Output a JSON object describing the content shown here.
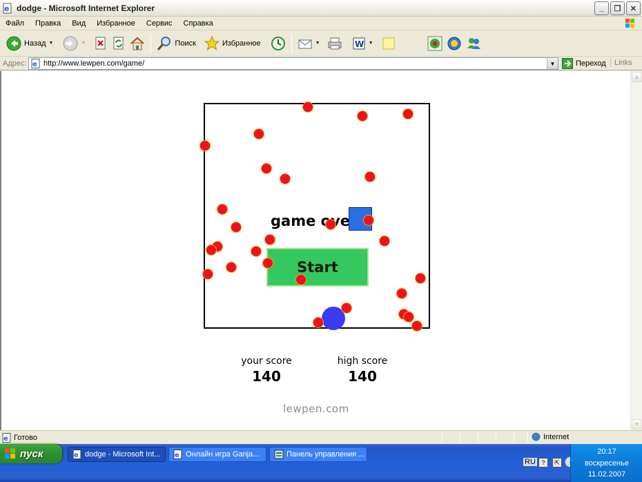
{
  "window": {
    "title": "dodge - Microsoft Internet Explorer",
    "minimize": "_",
    "maximize": "❐",
    "close": "✕"
  },
  "menu": {
    "items": [
      "Файл",
      "Правка",
      "Вид",
      "Избранное",
      "Сервис",
      "Справка"
    ]
  },
  "toolbar": {
    "back_label": "Назад",
    "search_label": "Поиск",
    "favorites_label": "Избранное"
  },
  "address": {
    "label": "Адрес:",
    "url": "http://www.lewpen.com/game/",
    "go_label": "Переход",
    "links_label": "Links"
  },
  "game": {
    "message": "game over",
    "start_label": "Start",
    "your_score_label": "your score",
    "your_score": "140",
    "high_score_label": "high score",
    "high_score": "140",
    "brand": "lewpen.com"
  },
  "status": {
    "text": "Готово",
    "zone": "Internet"
  },
  "taskbar": {
    "start_label": "пуск",
    "tasks": [
      {
        "label": "dodge - Microsoft Int..."
      },
      {
        "label": "Онлайн игра Ganja..."
      },
      {
        "label": "Панель управления ..."
      }
    ],
    "lang_indicator": "Ru",
    "lang": "RU",
    "time": "20:17",
    "day": "воскресенье",
    "date": "11.02.2007"
  },
  "colors": {
    "dot": "#ee1023",
    "dot_border": "#f7a600",
    "player": "#3b3bf2",
    "square": "#2a6fe6",
    "start_button": "#35c860"
  }
}
